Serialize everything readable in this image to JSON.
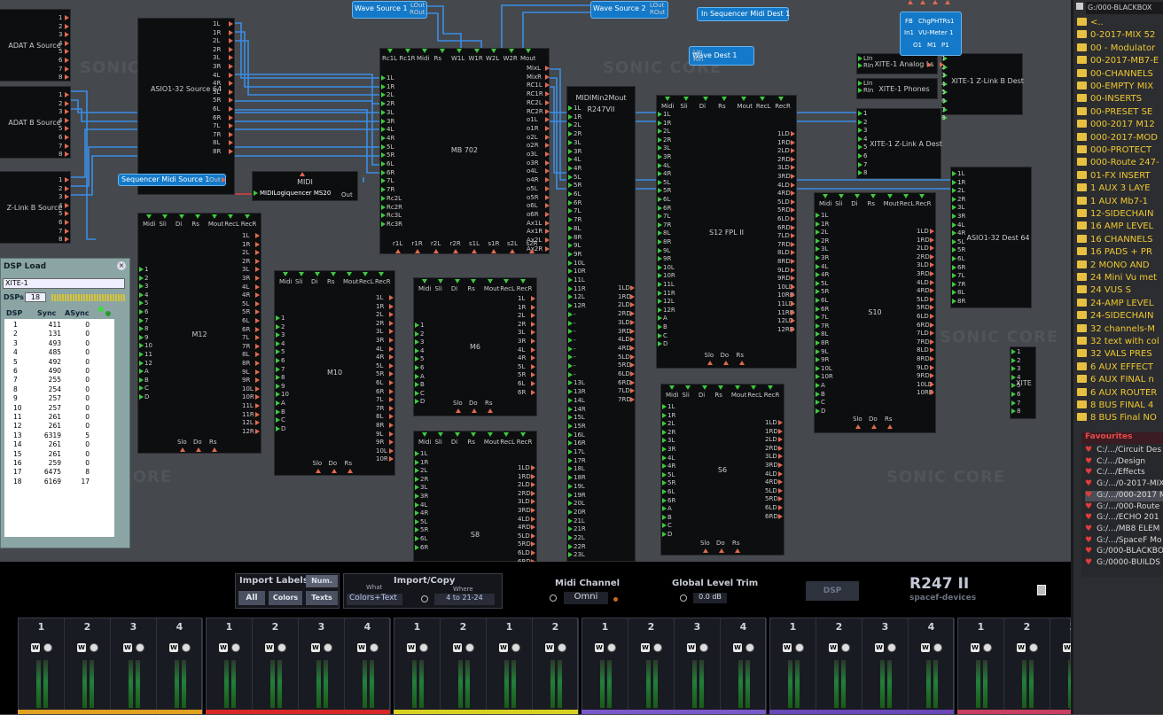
{
  "modules": {
    "adat_a": "ADAT A Source",
    "adat_b": "ADAT B Source",
    "zlink_b_src": "Z-Link B Source",
    "asio_src": "ASIO1-32 Source 64",
    "mb702": "MB 702",
    "r247": "R247VII",
    "s12": "S12 FPL II",
    "m12": "M12",
    "m10": "M10",
    "m6": "M6",
    "s8": "S8",
    "s6": "S6",
    "s10": "S10",
    "asio_dest": "ASIO1-32 Dest 64",
    "xite_zlink_a": "XITE-1 Z-Link A Dest",
    "xite_zlink_b": "XITE-1 Z-Link B Dest",
    "xite_analog": "XITE-1 Analog Ls",
    "xite_phones": "XITE-1 Phones",
    "xite_partial": "XITE",
    "wave_source1": "Wave Source 1",
    "wave_source2": "Wave Source 2",
    "seq_midi_dest": "In Sequencer Midi Dest 1",
    "wave_dest": "Wave Dest 1",
    "seq_midi_src": "Sequencer Midi Source 1",
    "midi_logi": "MIDILogiquencer MS20",
    "vu_meter": "VU-Meter 1",
    "midi_label": "MIDI",
    "r247_top": "MIDIMin2Mout"
  },
  "port_words": {
    "midi": "Midi",
    "sli": "Sli",
    "di": "Di",
    "rs": "Rs",
    "mout": "Mout",
    "recl": "RecL",
    "recr": "RecR",
    "slo": "Slo",
    "do": "Do",
    "out": "Out",
    "in": "In",
    "lout": "LOut",
    "rout": "ROut",
    "lin": "LIn",
    "rin": "RIn",
    "fb": "FB",
    "chgpht": "ChgPHTRs1",
    "in1": "In1",
    "o1": "O1",
    "m1": "M1",
    "p1": "P1"
  },
  "mb_ports": {
    "top": [
      "Rc1L",
      "Rc1R",
      "Midi",
      "Rs",
      "W1L",
      "W1R",
      "W2L",
      "W2R",
      "Mout"
    ],
    "left": [
      "1L",
      "1R",
      "2L",
      "2R",
      "3L",
      "3R",
      "4L",
      "4R",
      "5L",
      "5R",
      "6L",
      "6R",
      "7L",
      "7R",
      "Rc2L",
      "Rc2R",
      "Rc3L",
      "Rc3R"
    ],
    "right": [
      "MixL",
      "MixR",
      "RC1L",
      "RC1R",
      "RC2L",
      "RC2R",
      "o1L",
      "o1R",
      "o2L",
      "o2R",
      "o3L",
      "o3R",
      "o4L",
      "o4R",
      "o5L",
      "o5R",
      "o6L",
      "o6R",
      "Ax1L",
      "Ax1R",
      "Ax2L",
      "Ax2R"
    ],
    "bottom": [
      "r1L",
      "r1R",
      "r2L",
      "r2R",
      "s1L",
      "s1R",
      "s2L",
      "s2R"
    ]
  },
  "dsp_load": {
    "title": "DSP Load",
    "device": "XITE-1",
    "dsps_label": "DSPs",
    "dsps_value": "18",
    "headers": [
      "DSP",
      "Sync",
      "ASync"
    ],
    "rows": [
      [
        "1",
        "411",
        "0"
      ],
      [
        "2",
        "131",
        "0"
      ],
      [
        "3",
        "493",
        "0"
      ],
      [
        "4",
        "485",
        "0"
      ],
      [
        "5",
        "492",
        "0"
      ],
      [
        "6",
        "490",
        "0"
      ],
      [
        "7",
        "255",
        "0"
      ],
      [
        "8",
        "254",
        "0"
      ],
      [
        "9",
        "257",
        "0"
      ],
      [
        "10",
        "257",
        "0"
      ],
      [
        "11",
        "261",
        "0"
      ],
      [
        "12",
        "261",
        "0"
      ],
      [
        "13",
        "6319",
        "5"
      ],
      [
        "14",
        "261",
        "0"
      ],
      [
        "15",
        "261",
        "0"
      ],
      [
        "16",
        "259",
        "0"
      ],
      [
        "17",
        "6475",
        "8"
      ],
      [
        "18",
        "6169",
        "17"
      ]
    ]
  },
  "panel": {
    "import_labels": "Import Labels",
    "num": "Num.",
    "all": "All",
    "colors": "Colors",
    "texts": "Texts",
    "import_copy": "Import/Copy",
    "what": "What",
    "where": "Where",
    "what_value": "Colors+Text",
    "where_value": "4 to 21-24",
    "midi_channel": "Midi Channel",
    "midi_value": "Omni",
    "global_trim": "Global Level Trim",
    "trim_value": "0.0 dB",
    "dsp_button": "DSP",
    "product": "R247 II",
    "brand": "spacef-devices",
    "w": "W"
  },
  "channel_groups": [
    {
      "labels": [
        "1",
        "2",
        "3",
        "4"
      ],
      "color": "#e0a020"
    },
    {
      "labels": [
        "1",
        "2",
        "3",
        "4"
      ],
      "color": "#d82828"
    },
    {
      "labels": [
        "1",
        "2",
        "1",
        "2"
      ],
      "color": "#d8d020"
    },
    {
      "labels": [
        "1",
        "2",
        "3",
        "4"
      ],
      "color": "#7a58c8"
    },
    {
      "labels": [
        "1",
        "2",
        "3",
        "4"
      ],
      "color": "#6a48b8"
    },
    {
      "labels": [
        "1",
        "2",
        "3"
      ],
      "color": "#c84060"
    }
  ],
  "browser": {
    "path": "G:/000-BLACKBOX",
    "folders": [
      "<..",
      "0-2017-MIX 52",
      "00 - Modulator",
      "00-2017-MB7-E",
      "00-CHANNELS",
      "00-EMPTY MIX",
      "00-INSERTS",
      "00-PRESET SE",
      "000-2017 M12",
      "000-2017-MOD",
      "000-PROTECT",
      "000-Route 247-",
      "01-FX INSERT",
      "1 AUX 3 LAYE",
      "1 AUX Mb7-1",
      "12-SIDECHAIN",
      "16 AMP LEVEL",
      "16 CHANNELS",
      "16 PADS + PR",
      "2 MONO AND",
      "24 Mini Vu met",
      "24 VUS S",
      "24-AMP LEVEL",
      "24-SIDECHAIN",
      "32 channels-M",
      "32 text with col",
      "32 VALS PRES",
      "6 AUX EFFECT",
      "6 AUX FINAL n",
      "6 AUX ROUTER",
      "8 BUS FINAL 4",
      "8 BUS Final NO"
    ],
    "favourites_title": "Favourites",
    "favourites": [
      "C:/.../Circuit Des",
      "C:/.../Design",
      "C:/.../Effects",
      "G:/.../0-2017-MIX",
      "G:/.../000-2017 M",
      "G:/.../000-Route",
      "G:/.../ECHO 201",
      "G:/.../MB8 ELEM",
      "G:/.../SpaceF Mo",
      "G:/000-BLACKBO",
      "G:/0000-BUILDS"
    ]
  },
  "watermarks": [
    "SONIC CORE",
    "SONIC CORE",
    "SONIC CORE",
    "SONIC CORE",
    "SONIC CORE"
  ],
  "colors": {
    "wire": "#3a8ee8",
    "port_in": "#3ec93e",
    "port_out": "#e06a50",
    "panel_bg": "#000000",
    "module_blue": "#1479c8"
  }
}
